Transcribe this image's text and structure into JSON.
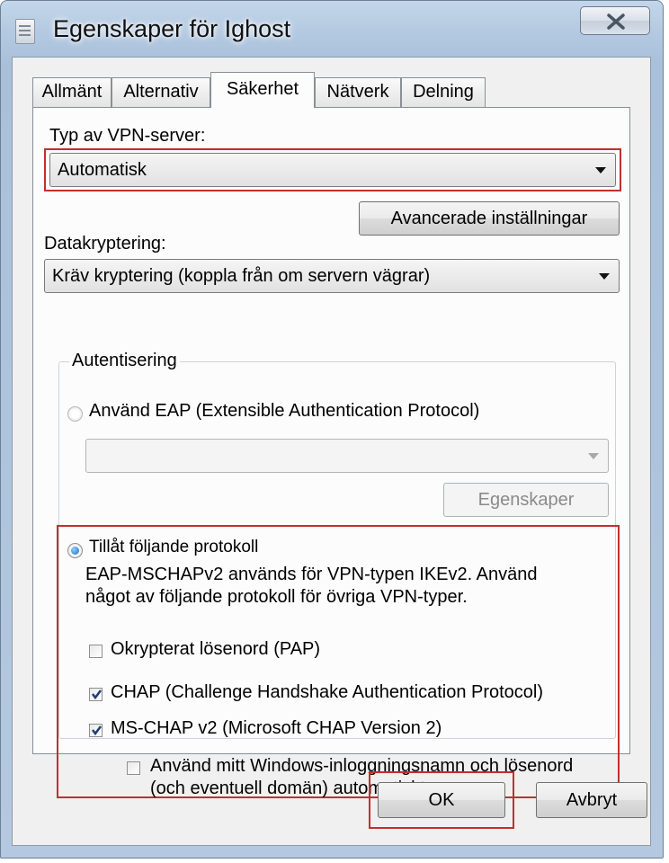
{
  "window": {
    "title": "Egenskaper för Ighost"
  },
  "tabs": [
    {
      "label": "Allmänt",
      "active": false
    },
    {
      "label": "Alternativ",
      "active": false
    },
    {
      "label": "Säkerhet",
      "active": true
    },
    {
      "label": "Nätverk",
      "active": false
    },
    {
      "label": "Delning",
      "active": false
    }
  ],
  "vpn_type": {
    "label": "Typ av VPN-server:",
    "value": "Automatisk"
  },
  "advanced_button": "Avancerade inställningar",
  "encryption": {
    "label": "Datakryptering:",
    "value": "Kräv kryptering (koppla från om servern vägrar)"
  },
  "auth": {
    "legend": "Autentisering",
    "eap_radio": "Använd EAP (Extensible Authentication Protocol)",
    "eap_combo_value": "",
    "eap_properties_button": "Egenskaper",
    "protocols_radio": "Tillåt följande protokoll",
    "note_line1": "EAP-MSCHAPv2 används för VPN-typen IKEv2. Använd",
    "note_line2": "något av följande protokoll för övriga VPN-typer.",
    "protocols": [
      {
        "label": "Okrypterat lösenord (PAP)",
        "checked": false
      },
      {
        "label": "CHAP (Challenge Handshake Authentication Protocol)",
        "checked": true
      },
      {
        "label": "MS-CHAP v2 (Microsoft CHAP Version 2)",
        "checked": true
      }
    ],
    "windows_login_line1": "Använd mitt Windows-inloggningsnamn och lösenord",
    "windows_login_line2": "(och eventuell domän) automatiskt",
    "windows_login_checked": false
  },
  "footer": {
    "ok": "OK",
    "cancel": "Avbryt"
  },
  "colors": {
    "highlight": "#c03030",
    "titlebar": "#b6cbe2",
    "panel": "#fcfcfc"
  }
}
